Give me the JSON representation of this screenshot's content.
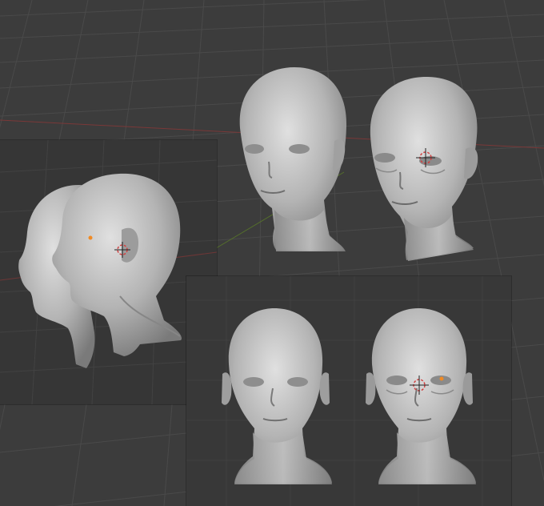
{
  "app": {
    "title": "",
    "description_visible_text": ""
  },
  "colors": {
    "viewport_bg": "#3c3c3c",
    "grid_line": "#4a4a4a",
    "x_axis": "#8a3a3a",
    "y_axis": "#5f7a2e",
    "panel_side_bg": "#363636",
    "panel_front_bg": "#383838",
    "head_light": "#d3d3d3",
    "head_mid": "#a9a9a9",
    "head_dark": "#6e6e6e",
    "origin_point": "#f08a24",
    "cursor_red": "#d14040"
  },
  "icons": {
    "cursor": "3d-cursor-icon",
    "origin": "origin-point-icon"
  },
  "views": {
    "perspective": [
      "young-head",
      "aged-head"
    ],
    "side": [
      "young-head-profile",
      "aged-head-profile"
    ],
    "front": [
      "young-head-front",
      "aged-head-front"
    ]
  }
}
